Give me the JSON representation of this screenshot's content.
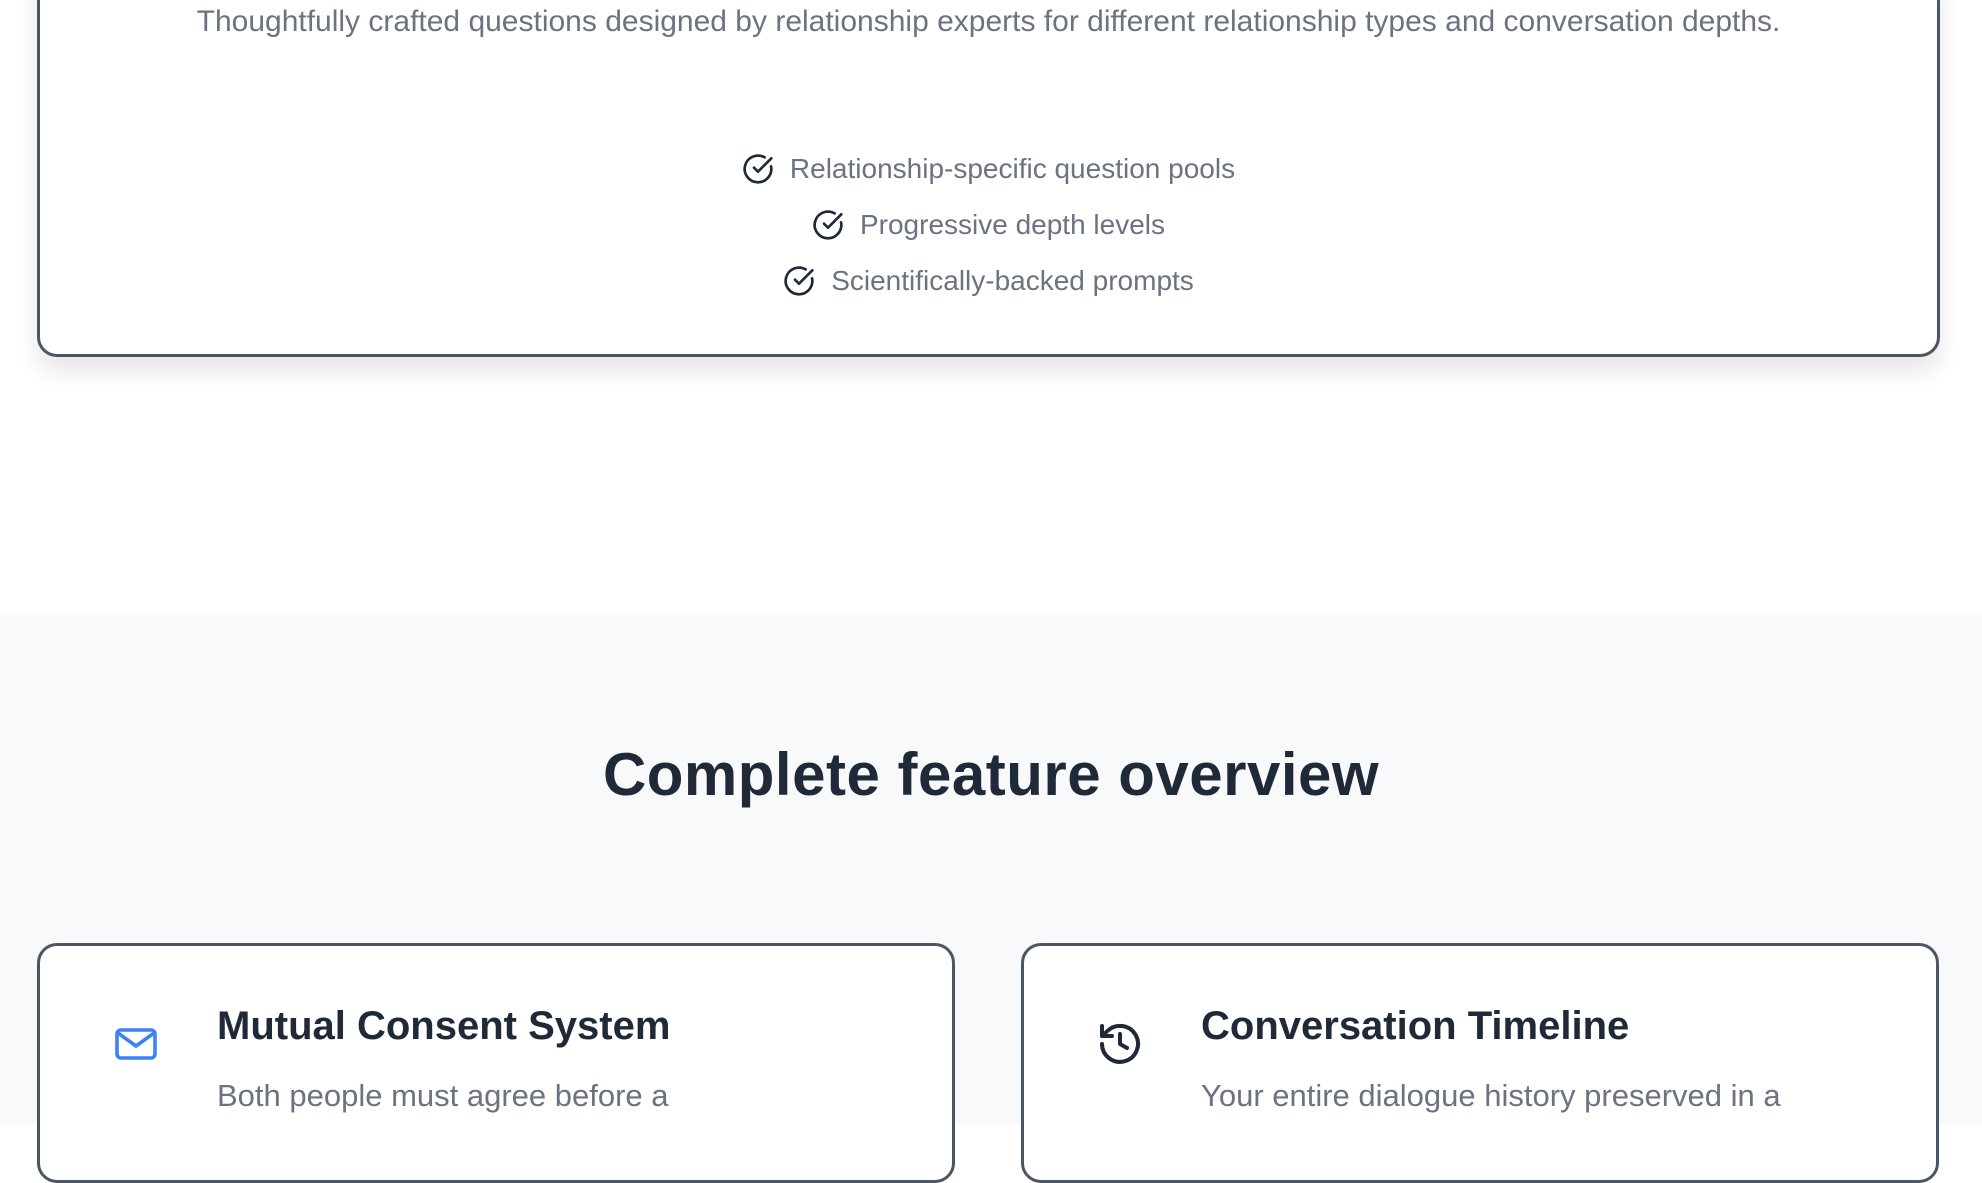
{
  "top_card": {
    "description": "Thoughtfully crafted questions designed by relationship experts for different relationship types and conversation depths.",
    "checklist": [
      "Relationship-specific question pools",
      "Progressive depth levels",
      "Scientifically-backed prompts"
    ]
  },
  "overview": {
    "title": "Complete feature overview",
    "features": [
      {
        "icon": "mail-icon",
        "title": "Mutual Consent System",
        "description": "Both people must agree before a"
      },
      {
        "icon": "history-icon",
        "title": "Conversation Timeline",
        "description": "Your entire dialogue history preserved in a"
      }
    ]
  },
  "colors": {
    "border": "#4b5563",
    "muted_text": "#6b7280",
    "heading": "#1f2937",
    "accent_icon": "#3b82f6",
    "section_bg": "#f8f9fb"
  }
}
